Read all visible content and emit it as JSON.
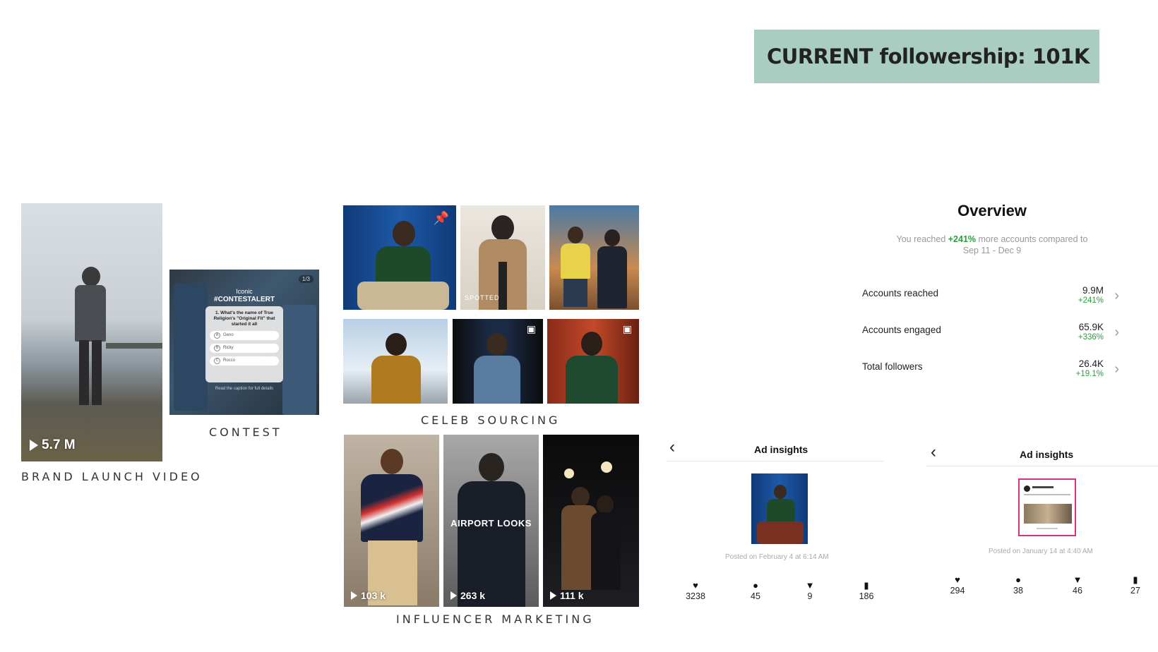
{
  "banner": {
    "text": "CURRENT followership: 101K"
  },
  "brand_launch": {
    "views": "5.7 M",
    "caption": "BRAND LAUNCH VIDEO"
  },
  "contest": {
    "caption": "CONTEST",
    "overlay_brand": "Iconic",
    "overlay_tag": "#CONTESTALERT",
    "page": "1/3",
    "question": "1. What's the name of True Religion's \"Original Fit\" that started it all",
    "options": [
      {
        "letter": "A",
        "text": "Geno"
      },
      {
        "letter": "B",
        "text": "Ricky"
      },
      {
        "letter": "C",
        "text": "Rocco"
      }
    ],
    "footnote": "Read the caption for full details"
  },
  "celeb": {
    "caption": "CELEB SOURCING",
    "spotted_label": "SPOTTED"
  },
  "influencer": {
    "caption": "INFLUENCER MARKETING",
    "airport_label": "AIRPORT LOOKS",
    "views": [
      "103 k",
      "263 k",
      "111 k"
    ]
  },
  "overview": {
    "title": "Overview",
    "subtitle_prefix": "You reached ",
    "subtitle_pct": "+241%",
    "subtitle_suffix": " more accounts compared to",
    "subtitle_range": "Sep 11 - Dec 9",
    "rows": [
      {
        "label": "Accounts reached",
        "value": "9.9M",
        "change": "+241%"
      },
      {
        "label": "Accounts engaged",
        "value": "65.9K",
        "change": "+336%"
      },
      {
        "label": "Total followers",
        "value": "26.4K",
        "change": "+19.1%"
      }
    ]
  },
  "ad_insights": [
    {
      "title": "Ad insights",
      "posted": "Posted on February 4 at 6:14 AM",
      "stats": [
        {
          "icon": "heart-icon",
          "value": "3238"
        },
        {
          "icon": "comment-icon",
          "value": "45"
        },
        {
          "icon": "share-icon",
          "value": "9"
        },
        {
          "icon": "bookmark-icon",
          "value": "186"
        }
      ]
    },
    {
      "title": "Ad insights",
      "posted": "Posted on January 14 at 4:40 AM",
      "stats": [
        {
          "icon": "heart-icon",
          "value": "294"
        },
        {
          "icon": "comment-icon",
          "value": "38"
        },
        {
          "icon": "share-icon",
          "value": "46"
        },
        {
          "icon": "bookmark-icon",
          "value": "27"
        }
      ]
    }
  ],
  "colors": {
    "banner_bg": "#a9cdc1",
    "positive": "#2a9d3a",
    "ad_thumb_border": "#d6337f"
  }
}
